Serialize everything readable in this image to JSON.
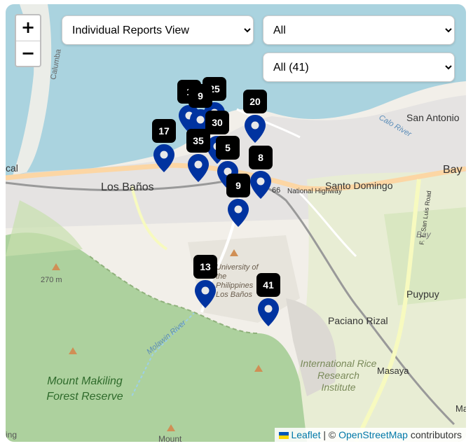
{
  "controls": {
    "zoom_in": "+",
    "zoom_out": "−",
    "view_select": {
      "selected": "Individual Reports View"
    },
    "category_select": {
      "selected": "All"
    },
    "count_select": {
      "selected": "All (41)"
    }
  },
  "markers": [
    {
      "label": "1"
    },
    {
      "label": "25"
    },
    {
      "label": "9"
    },
    {
      "label": "20"
    },
    {
      "label": "30"
    },
    {
      "label": "17"
    },
    {
      "label": "35"
    },
    {
      "label": "5"
    },
    {
      "label": "8"
    },
    {
      "label": "9"
    },
    {
      "label": "13"
    },
    {
      "label": "41"
    }
  ],
  "map_labels": {
    "calumba": "Calumba",
    "san_antonio": "San Antonio",
    "bay": "Bay",
    "bay_small": "Bay",
    "los_banos": "Los Baños",
    "santo_domingo": "Santo Domingo",
    "national_highway": "National Highway",
    "highway_number": "66",
    "cal": "cal",
    "calo_river": "Calo River",
    "university": "University of the Philippines Los Baños",
    "elevation": "270 m",
    "puypuy": "Puypuy",
    "paciano_rizal": "Paciano Rizal",
    "irri": "International Rice Research Institute",
    "masaya": "Masaya",
    "mount_makiling": "Mount Makiling Forest Reserve",
    "san_luis": "F. T. San Luis Road",
    "molawin": "Molawin River",
    "mount": "Mount",
    "ma": "Ma",
    "ing": "ing"
  },
  "attribution": {
    "leaflet": "Leaflet",
    "separator": "| ©",
    "osm": "OpenStreetMap",
    "contributors": "contributors"
  },
  "colors": {
    "water": "#aad3df",
    "land": "#f2efe9",
    "forest": "#add19e",
    "marker_blue": "#0033a0",
    "badge": "#000000",
    "highway": "#fcd6a4"
  }
}
